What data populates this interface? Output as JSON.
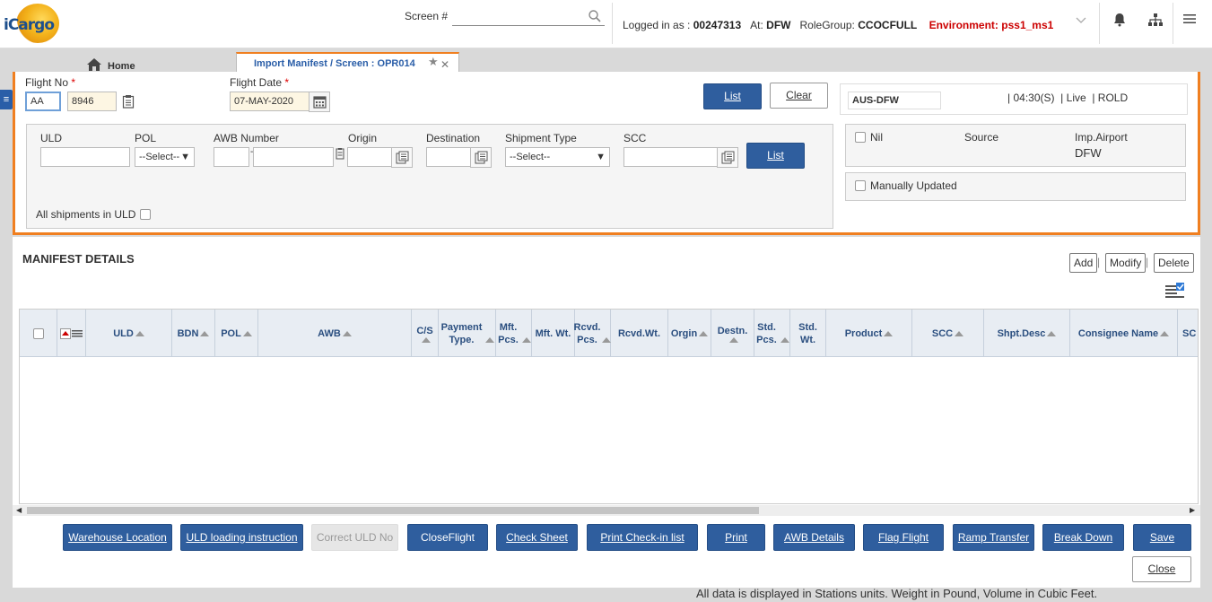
{
  "app": {
    "logo_text": "iCargo"
  },
  "topbar": {
    "screen_label": "Screen #",
    "screen_value": "",
    "logged_in_label": "Logged in as :",
    "user_id": "00247313",
    "at_label": "At:",
    "station": "DFW",
    "role_label": "RoleGroup:",
    "role": "CCOCFULL",
    "env_label": "Environment:",
    "env": "pss1_ms1"
  },
  "tabs": {
    "home": "Home",
    "active": "Import Manifest / Screen : OPR014"
  },
  "form": {
    "flight_no_label": "Flight No",
    "required_mark": "*",
    "carrier": "AA",
    "flight_number": "8946",
    "flight_date_label": "Flight Date",
    "flight_date": "07-MAY-2020",
    "list_label": "List",
    "clear_label": "Clear"
  },
  "flight_info": {
    "route": "AUS-DFW",
    "time": "04:30(S)",
    "status": "Live",
    "extra": "ROLD",
    "sep": "|"
  },
  "filters": {
    "uld_label": "ULD",
    "uld_value": "",
    "pol_label": "POL",
    "pol_value": "--Select--",
    "awb_label": "AWB Number",
    "awb_prefix": "",
    "awb_dash": "-",
    "awb_number": "",
    "origin_label": "Origin",
    "origin_value": "",
    "destination_label": "Destination",
    "destination_value": "",
    "shipment_type_label": "Shipment Type",
    "shipment_type_value": "--Select--",
    "scc_label": "SCC",
    "scc_value": "",
    "list_label": "List",
    "all_shipments_label": "All shipments in ULD"
  },
  "side": {
    "nil_label": "Nil",
    "source_label": "Source",
    "imp_airport_label": "Imp.Airport",
    "imp_airport_value": "DFW",
    "manually_updated_label": "Manually Updated"
  },
  "manifest": {
    "title": "MANIFEST DETAILS",
    "add": "Add",
    "modify": "Modify",
    "delete": "Delete",
    "sep": "|",
    "columns": [
      "ULD",
      "BDN",
      "POL",
      "AWB",
      "C/S",
      "Payment Type.",
      "Mft. Pcs.",
      "Mft. Wt.",
      "Rcvd. Pcs.",
      "Rcvd.Wt.",
      "Orgin",
      "Destn.",
      "Std. Pcs.",
      "Std. Wt.",
      "Product",
      "SCC",
      "Shpt.Desc",
      "Consignee Name",
      "SC"
    ]
  },
  "actions": {
    "warehouse_location": "Warehouse Location",
    "uld_loading_instruction": "ULD loading instruction",
    "correct_uld_no": "Correct ULD No",
    "close_flight": "CloseFlight",
    "check_sheet": "Check Sheet",
    "print_checkin_list": "Print Check-in list",
    "print": "Print",
    "awb_details": "AWB Details",
    "flag_flight": "Flag Flight",
    "ramp_transfer": "Ramp Transfer",
    "break_down": "Break Down",
    "save": "Save",
    "close": "Close"
  },
  "footer": {
    "note": "All data is displayed in Stations units. Weight in Pound, Volume in Cubic Feet."
  },
  "colors": {
    "accent": "#f07f20",
    "primary": "#2f5e9e",
    "env": "#cc0000"
  }
}
